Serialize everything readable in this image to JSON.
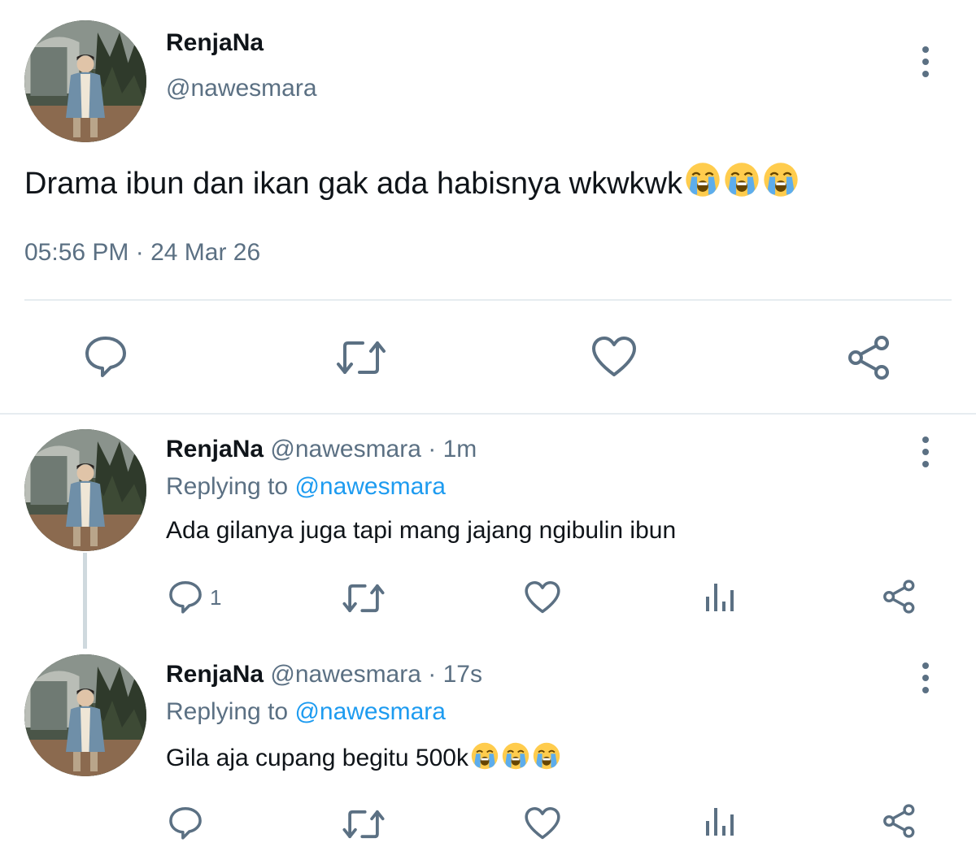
{
  "main_tweet": {
    "display_name": "RenjaNa",
    "handle": "@nawesmara",
    "text": "Drama ibun dan ikan gak ada habisnya wkwkwk",
    "emojis": [
      "loudly-crying-face-icon",
      "loudly-crying-face-icon",
      "loudly-crying-face-icon"
    ],
    "timestamp": "05:56 PM · 24 Mar 26",
    "actions": {
      "reply": "reply-icon",
      "retweet": "retweet-icon",
      "like": "like-icon",
      "share": "share-icon"
    }
  },
  "replies": [
    {
      "display_name": "RenjaNa",
      "handle": "@nawesmara",
      "time": "· 1m",
      "replying_prefix": "Replying to",
      "replying_to": "@nawesmara",
      "text": "Ada gilanya juga tapi mang jajang ngibulin ibun",
      "reply_count": "1",
      "icons": [
        "reply-icon",
        "retweet-icon",
        "like-icon",
        "analytics-icon",
        "share-icon"
      ]
    },
    {
      "display_name": "RenjaNa",
      "handle": "@nawesmara",
      "time": "· 17s",
      "replying_prefix": "Replying to",
      "replying_to": "@nawesmara",
      "text": "Gila aja cupang begitu 500k",
      "emojis": [
        "loudly-crying-face-icon",
        "loudly-crying-face-icon",
        "loudly-crying-face-icon"
      ],
      "icons": [
        "reply-icon",
        "retweet-icon",
        "like-icon",
        "analytics-icon",
        "share-icon"
      ]
    }
  ],
  "colors": {
    "text_primary": "#0f1419",
    "text_muted": "#5b7083",
    "link": "#1d9bf0",
    "divider": "#e6ecf0"
  }
}
